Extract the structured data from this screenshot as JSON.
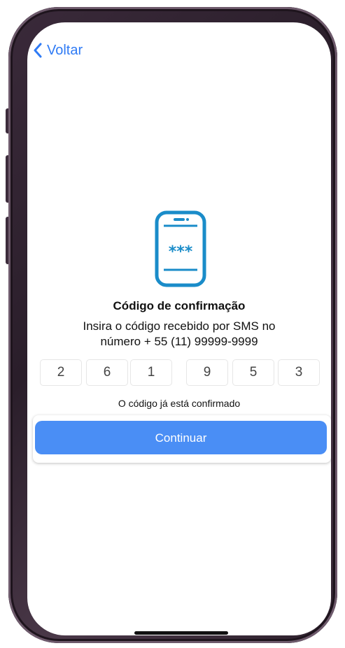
{
  "nav": {
    "back_label": "Voltar"
  },
  "verification": {
    "icon": "phone-password-icon",
    "icon_mask": "***",
    "title": "Código de confirmação",
    "description_line1": "Insira o código recebido por SMS no",
    "description_line2": "número + 55 (11) 99999-9999",
    "code_digits": [
      "2",
      "6",
      "1",
      "9",
      "5",
      "3"
    ],
    "status": "O código já está confirmado"
  },
  "actions": {
    "continue_label": "Continuar"
  },
  "colors": {
    "accent": "#2f7bf5",
    "button": "#4a8ef5",
    "icon": "#1a8cc9",
    "phone_frame": "#3a2a3a"
  }
}
